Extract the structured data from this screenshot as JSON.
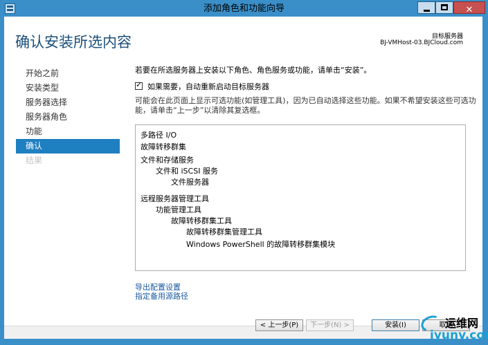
{
  "window": {
    "title": "添加角色和功能向导"
  },
  "header": {
    "page_title": "确认安装所选内容",
    "target_label": "目标服务器",
    "target_value": "BJ-VMHost-03.BJCloud.com"
  },
  "nav": {
    "items": [
      {
        "label": "开始之前",
        "state": "normal"
      },
      {
        "label": "安装类型",
        "state": "normal"
      },
      {
        "label": "服务器选择",
        "state": "normal"
      },
      {
        "label": "服务器角色",
        "state": "normal"
      },
      {
        "label": "功能",
        "state": "normal"
      },
      {
        "label": "确认",
        "state": "active"
      },
      {
        "label": "结果",
        "state": "disabled"
      }
    ]
  },
  "content": {
    "intro": "若要在所选服务器上安装以下角色、角色服务或功能，请单击“安装”。",
    "restart_checkbox_label": "如果需要，自动重新启动目标服务器",
    "restart_checked": true,
    "note_line1": "可能会在此页面上显示可选功能(如管理工具)，因为已自动选择这些功能。如果不希望安装这些可选功",
    "note_line2": "能，请单击“上一步”以清除其复选框。",
    "selections": [
      {
        "label": "多路径 I/O",
        "level": 0
      },
      {
        "label": "故障转移群集",
        "level": 0
      },
      {
        "label": "文件和存储服务",
        "level": 0
      },
      {
        "label": "文件和 iSCSI 服务",
        "level": 1
      },
      {
        "label": "文件服务器",
        "level": 2
      },
      {
        "label": "远程服务器管理工具",
        "level": 0
      },
      {
        "label": "功能管理工具",
        "level": 1
      },
      {
        "label": "故障转移群集工具",
        "level": 2
      },
      {
        "label": "故障转移群集管理工具",
        "level": 3
      },
      {
        "label": "Windows PowerShell 的故障转移群集模块",
        "level": 3
      }
    ],
    "export_link": "导出配置设置",
    "alt_source_link": "指定备用源路径"
  },
  "footer": {
    "prev_label": "< 上一步(P)",
    "next_label": "下一步(N) >",
    "install_label": "安装(I)",
    "cancel_label": "取消"
  },
  "watermark": {
    "line1": "运维网",
    "line2": "iyunv.com"
  },
  "colors": {
    "accent": "#3a8fc9",
    "nav_active": "#1e7fc1",
    "title_text": "#1b4f7a",
    "link": "#1a5aa0",
    "watermark": "#1aa0d8"
  },
  "icons": {
    "window": "server-manager-icon",
    "minimize": "minimize-icon",
    "maximize": "maximize-icon",
    "close": "close-icon"
  }
}
